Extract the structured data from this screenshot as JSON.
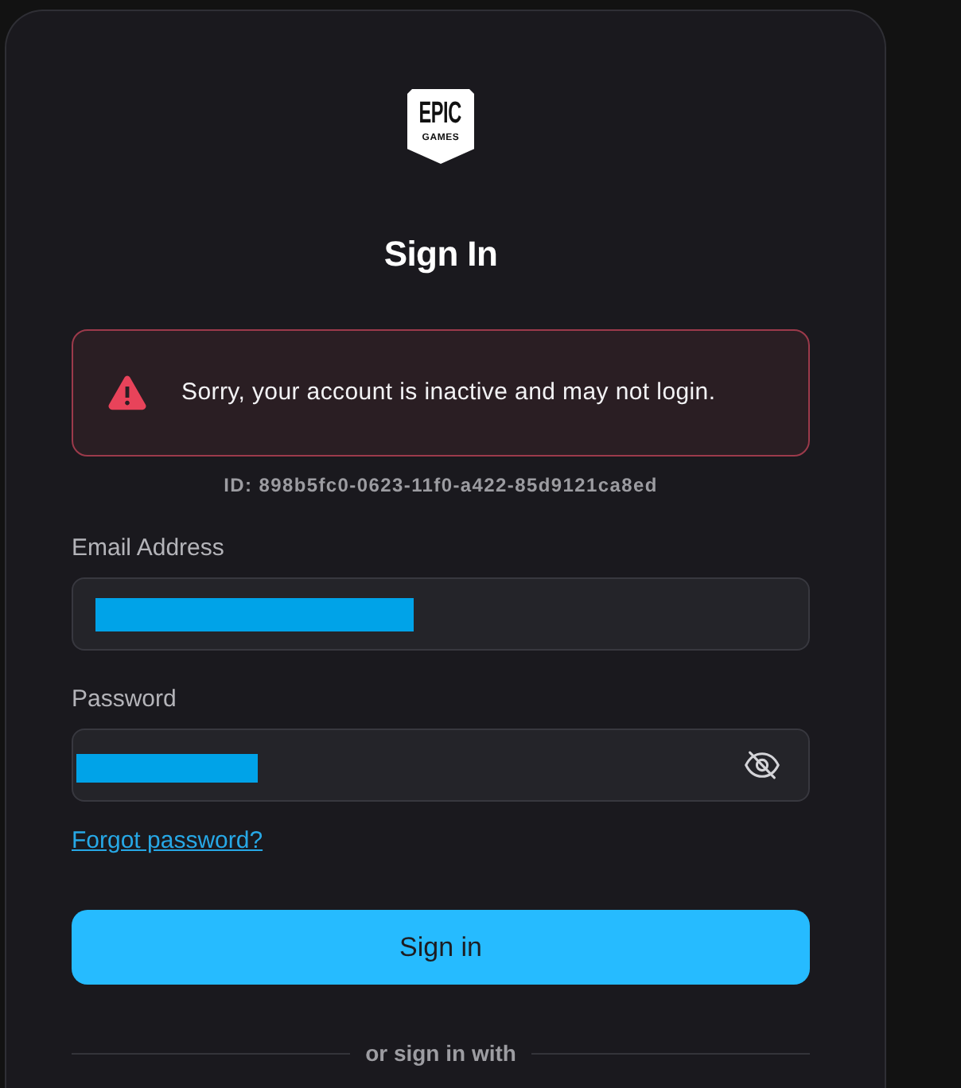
{
  "logo": {
    "wordmark": "EPIC",
    "subtitle": "GAMES"
  },
  "title": "Sign In",
  "alert": {
    "kind": "error",
    "message": "Sorry, your account is inactive and may not login.",
    "reference": "ID: 898b5fc0-0623-11f0-a422-85d9121ca8ed"
  },
  "fields": [
    {
      "kind": "email",
      "label": "Email Address",
      "redacted": true
    },
    {
      "kind": "password",
      "label": "Password",
      "redacted": true,
      "password_visible": false
    }
  ],
  "forgot_link": "Forgot password?",
  "submit_button": "Sign in",
  "divider_text": "or sign in with"
}
